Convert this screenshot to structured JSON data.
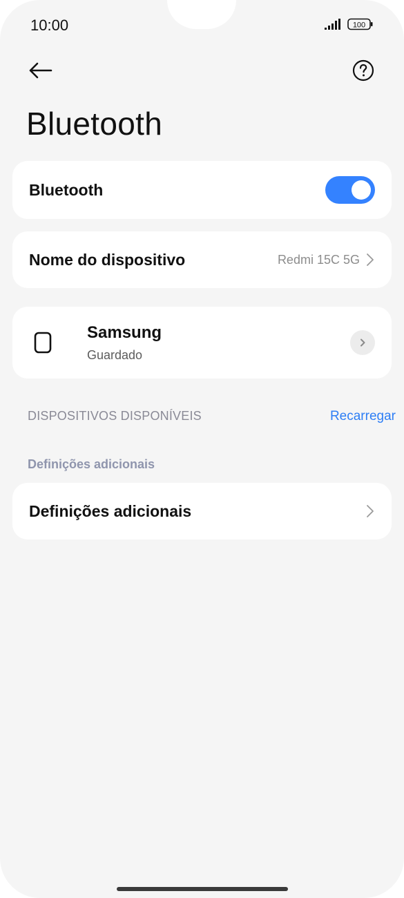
{
  "status_bar": {
    "time": "10:00",
    "battery": "100",
    "signal_icon": "signal-bars-icon",
    "battery_icon": "battery-icon"
  },
  "header": {
    "back_icon": "arrow-left-icon",
    "help_icon": "help-circle-icon",
    "title": "Bluetooth"
  },
  "bluetooth_toggle": {
    "label": "Bluetooth",
    "state": "on",
    "accent_color": "#3482ff"
  },
  "device_name_row": {
    "label": "Nome do dispositivo",
    "value": "Redmi 15C 5G"
  },
  "saved_devices": [
    {
      "name": "Samsung",
      "status": "Guardado",
      "icon": "smartwatch-icon"
    }
  ],
  "available_section": {
    "header": "DISPOSITIVOS DISPONÍVEIS",
    "reload_label": "Recarregar",
    "link_color": "#2d7ef5"
  },
  "additional_section": {
    "header": "Definições adicionais",
    "row_label": "Definições adicionais"
  }
}
